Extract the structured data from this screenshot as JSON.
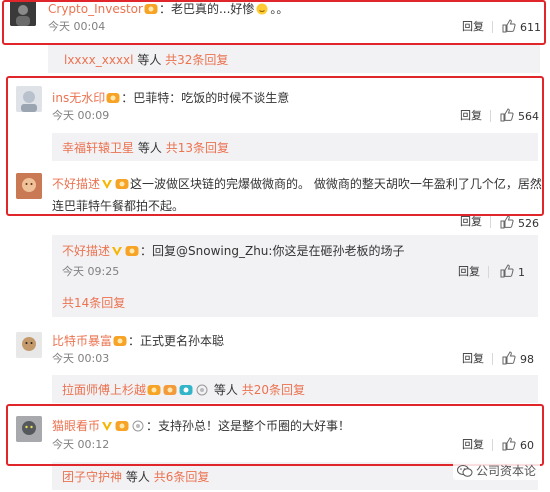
{
  "comments": [
    {
      "user": "Crypto_Investor",
      "separator": "：",
      "text": "老巴真的...好惨",
      "text_tail": "。。",
      "time": "今天 00:04",
      "reply": "回复",
      "likes": "611",
      "sub_users": "lxxxx_xxxxl",
      "sub_mid": "等人",
      "sub_total": "共32条回复"
    },
    {
      "user": "ins无水印",
      "separator": "：",
      "text": "巴菲特：吃饭的时候不谈生意",
      "time": "今天 00:09",
      "reply": "回复",
      "likes": "564",
      "sub_users": "幸福轩辕卫星",
      "sub_mid": "等人",
      "sub_total": "共13条回复"
    },
    {
      "user": "不好描述",
      "separator": "：",
      "text": "这一波做区块链的完爆做微商的。 做微商的整天胡吹一年盈利了几个亿，居然连巴菲特午餐都拍不起。",
      "reply": "回复",
      "likes": "526",
      "reply_entry": {
        "user": "不好描述",
        "text": "回复@Snowing_Zhu:你这是在砸孙老板的场子",
        "time": "今天 09:25",
        "reply": "回复",
        "likes": "1"
      },
      "sub_total": "共14条回复"
    },
    {
      "user": "比特币暴富",
      "separator": "：",
      "text": "正式更名孙本聪",
      "time": "今天 00:03",
      "reply": "回复",
      "likes": "98",
      "sub_users": "拉面师傅上杉越",
      "sub_mid": "等人",
      "sub_total": "共20条回复"
    },
    {
      "user": "猫眼看币",
      "separator": "：",
      "text": "支持孙总！这是整个币圈的大好事！",
      "time": "今天 00:12",
      "reply": "回复",
      "likes": "60",
      "sub_users": "团子守护神",
      "sub_mid": "等人",
      "sub_total": "共6条回复"
    }
  ],
  "watermark": "公司资本论",
  "colors": {
    "username": "#eb7350",
    "highlight_border": "#e0262a",
    "reply_panel": "#f2f2f5"
  },
  "icons": [
    "thumb-up-icon",
    "verified-icon",
    "member-badge-icon",
    "wechat-icon"
  ]
}
